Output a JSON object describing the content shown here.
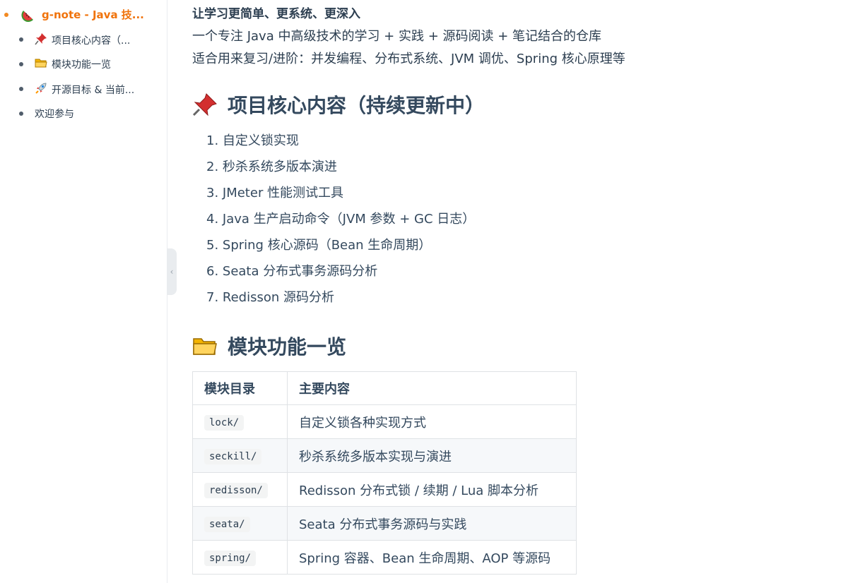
{
  "sidebar": {
    "top_item": "g-note - Java 技...",
    "items": [
      {
        "icon": "pushpin-icon",
        "label": "项目核心内容（..."
      },
      {
        "icon": "folder-icon",
        "label": "模块功能一览"
      },
      {
        "icon": "rocket-icon",
        "label": "开源目标 & 当前..."
      },
      {
        "icon": "",
        "label": "欢迎参与"
      }
    ]
  },
  "content": {
    "intro": [
      "让学习更简单、更系统、更深入",
      "一个专注 Java 中高级技术的学习 + 实践 + 源码阅读 + 笔记结合的仓库",
      "适合用来复习/进阶：并发编程、分布式系统、JVM 调优、Spring 核心原理等"
    ],
    "section1_title": "项目核心内容（持续更新中）",
    "section1_list": [
      "1. 自定义锁实现",
      "2. 秒杀系统多版本演进",
      "3. JMeter 性能测试工具",
      "4. Java 生产启动命令（JVM 参数 + GC 日志）",
      "5. Spring 核心源码（Bean 生命周期）",
      "6. Seata 分布式事务源码分析",
      "7. Redisson 源码分析"
    ],
    "section2_title": "模块功能一览",
    "table": {
      "headers": [
        "模块目录",
        "主要内容"
      ],
      "rows": [
        [
          "lock/",
          "自定义锁各种实现方式"
        ],
        [
          "seckill/",
          "秒杀系统多版本实现与演进"
        ],
        [
          "redisson/",
          "Redisson 分布式锁 / 续期 / Lua 脚本分析"
        ],
        [
          "seata/",
          "Seata 分布式事务源码与实践"
        ],
        [
          "spring/",
          "Spring 容器、Bean 生命周期、AOP 等源码"
        ]
      ]
    }
  },
  "colors": {
    "accent": "#f0730c",
    "text": "#2c3e50",
    "heading": "#34495e",
    "border": "#dfe2e5"
  }
}
